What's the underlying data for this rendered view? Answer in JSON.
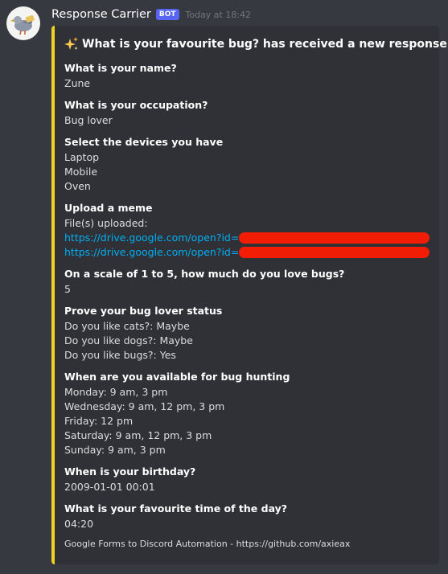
{
  "message": {
    "username": "Response Carrier",
    "badge": "BOT",
    "timestamp": "Today at 18:42"
  },
  "embed": {
    "accent_color": "#f2d325",
    "title_icon": "sparkles-icon",
    "title": "What is your favourite bug? has received a new response!",
    "fields": [
      {
        "name": "What is your name?",
        "values": [
          "Zune"
        ]
      },
      {
        "name": "What is your occupation?",
        "values": [
          "Bug lover"
        ]
      },
      {
        "name": "Select the devices you have",
        "values": [
          "Laptop",
          "Mobile",
          "Oven"
        ]
      },
      {
        "name": "Upload a meme",
        "intro": "File(s) uploaded:",
        "links": [
          "https://drive.google.com/open?id=",
          "https://drive.google.com/open?id="
        ]
      },
      {
        "name": "On a scale of 1 to 5, how much do you love bugs?",
        "values": [
          "5"
        ]
      },
      {
        "name": "Prove your bug lover status",
        "values": [
          "Do you like cats?: Maybe",
          "Do you like dogs?: Maybe",
          "Do you like bugs?: Yes"
        ]
      },
      {
        "name": "When are you available for bug hunting",
        "values": [
          "Monday: 9 am, 3 pm",
          "Wednesday: 9 am, 12 pm, 3 pm",
          "Friday: 12 pm",
          "Saturday: 9 am, 12 pm, 3 pm",
          "Sunday: 9 am, 3 pm"
        ]
      },
      {
        "name": "When is your birthday?",
        "values": [
          "2009-01-01 00:01"
        ]
      },
      {
        "name": "What is your favourite time of the day?",
        "values": [
          "04:20"
        ]
      }
    ],
    "footer": "Google Forms to Discord Automation - https://github.com/axieax"
  }
}
